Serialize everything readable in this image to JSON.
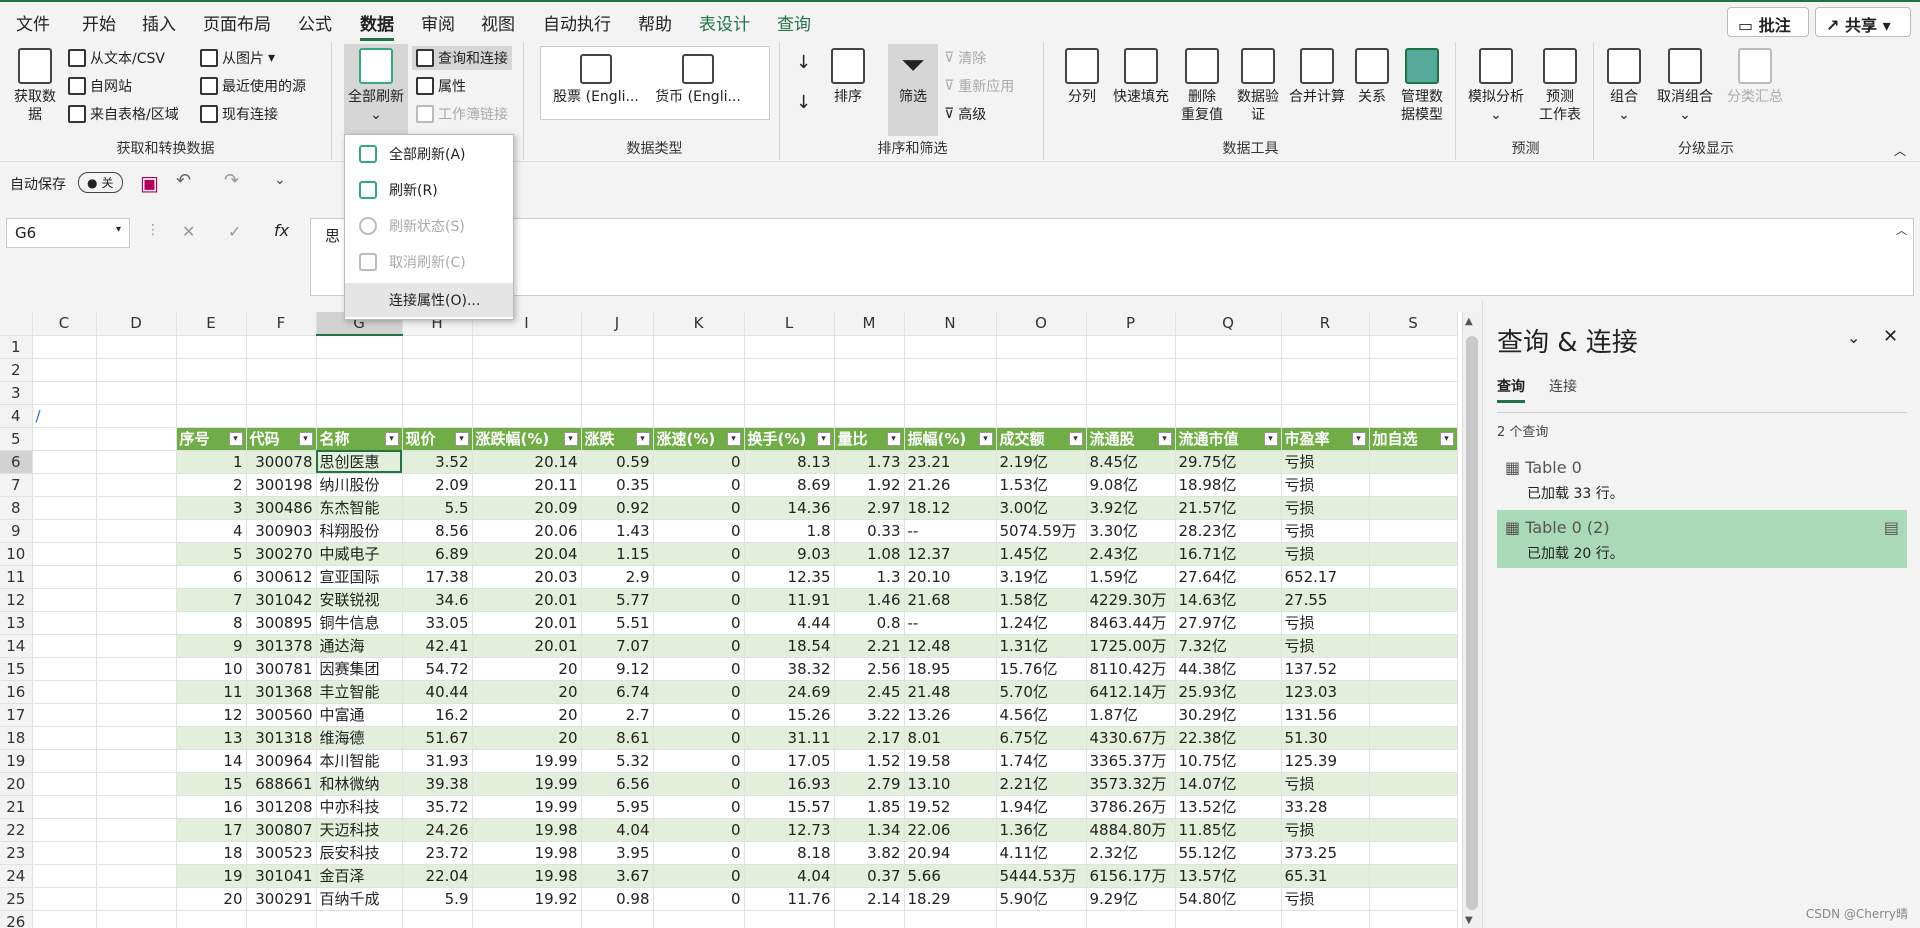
{
  "menu": {
    "tabs": [
      "文件",
      "开始",
      "插入",
      "页面布局",
      "公式",
      "数据",
      "审阅",
      "视图",
      "自动执行",
      "帮助",
      "表设计",
      "查询"
    ],
    "comment_btn": "批注",
    "share_btn": "共享"
  },
  "ribbon": {
    "get_data": {
      "big": "获取数\n据",
      "items": [
        "从文本/CSV",
        "自网站",
        "来自表格/区域",
        "从图片",
        "最近使用的源",
        "现有连接"
      ],
      "label": "获取和转换数据"
    },
    "queries": {
      "refresh_all": "全部刷新",
      "items": [
        "查询和连接",
        "属性",
        "工作簿链接"
      ]
    },
    "data_types": {
      "stock": "股票 (Engli...",
      "currency": "货币 (Engli...",
      "label": "数据类型"
    },
    "sort_filter": {
      "sort": "排序",
      "filter": "筛选",
      "clear": "清除",
      "reapply": "重新应用",
      "advanced": "高级",
      "label": "排序和筛选"
    },
    "data_tools": {
      "items": [
        "分列",
        "快速填充",
        "删除\n重复值",
        "数据验\n证",
        "合并计算",
        "关系",
        "管理数\n据模型"
      ],
      "label": "数据工具"
    },
    "forecast": {
      "items": [
        "模拟分析",
        "预测\n工作表"
      ],
      "label": "预测"
    },
    "outline": {
      "items": [
        "组合",
        "取消组合",
        "分类汇总"
      ],
      "label": "分级显示"
    }
  },
  "dropdown": {
    "items": [
      "全部刷新(A)",
      "刷新(R)",
      "刷新状态(S)",
      "取消刷新(C)",
      "连接属性(O)..."
    ]
  },
  "quick": {
    "autosave": "自动保存",
    "toggle": "关"
  },
  "formula": {
    "cell": "G6",
    "fx": "fx",
    "content": "思"
  },
  "columns": [
    "C",
    "D",
    "E",
    "F",
    "G",
    "H",
    "I",
    "J",
    "K",
    "L",
    "M",
    "N",
    "O",
    "P",
    "Q",
    "R",
    "S"
  ],
  "headers": [
    "序号",
    "代码",
    "名称",
    "现价",
    "涨跌幅(%)",
    "涨跌",
    "涨速(%)",
    "换手(%)",
    "量比",
    "振幅(%)",
    "成交额",
    "流通股",
    "流通市值",
    "市盈率",
    "加自选"
  ],
  "rows": [
    [
      "1",
      "300078",
      "思创医惠",
      "3.52",
      "20.14",
      "0.59",
      "0",
      "8.13",
      "1.73",
      "23.21",
      "2.19亿",
      "8.45亿",
      "29.75亿",
      "亏损",
      ""
    ],
    [
      "2",
      "300198",
      "纳川股份",
      "2.09",
      "20.11",
      "0.35",
      "0",
      "8.69",
      "1.92",
      "21.26",
      "1.53亿",
      "9.08亿",
      "18.98亿",
      "亏损",
      ""
    ],
    [
      "3",
      "300486",
      "东杰智能",
      "5.5",
      "20.09",
      "0.92",
      "0",
      "14.36",
      "2.97",
      "18.12",
      "3.00亿",
      "3.92亿",
      "21.57亿",
      "亏损",
      ""
    ],
    [
      "4",
      "300903",
      "科翔股份",
      "8.56",
      "20.06",
      "1.43",
      "0",
      "1.8",
      "0.33",
      "--",
      "5074.59万",
      "3.30亿",
      "28.23亿",
      "亏损",
      ""
    ],
    [
      "5",
      "300270",
      "中威电子",
      "6.89",
      "20.04",
      "1.15",
      "0",
      "9.03",
      "1.08",
      "12.37",
      "1.45亿",
      "2.43亿",
      "16.71亿",
      "亏损",
      ""
    ],
    [
      "6",
      "300612",
      "宣亚国际",
      "17.38",
      "20.03",
      "2.9",
      "0",
      "12.35",
      "1.3",
      "20.10",
      "3.19亿",
      "1.59亿",
      "27.64亿",
      "652.17",
      ""
    ],
    [
      "7",
      "301042",
      "安联锐视",
      "34.6",
      "20.01",
      "5.77",
      "0",
      "11.91",
      "1.46",
      "21.68",
      "1.58亿",
      "4229.30万",
      "14.63亿",
      "27.55",
      ""
    ],
    [
      "8",
      "300895",
      "铜牛信息",
      "33.05",
      "20.01",
      "5.51",
      "0",
      "4.44",
      "0.8",
      "--",
      "1.24亿",
      "8463.44万",
      "27.97亿",
      "亏损",
      ""
    ],
    [
      "9",
      "301378",
      "通达海",
      "42.41",
      "20.01",
      "7.07",
      "0",
      "18.54",
      "2.21",
      "12.48",
      "1.31亿",
      "1725.00万",
      "7.32亿",
      "亏损",
      ""
    ],
    [
      "10",
      "300781",
      "因赛集团",
      "54.72",
      "20",
      "9.12",
      "0",
      "38.32",
      "2.56",
      "18.95",
      "15.76亿",
      "8110.42万",
      "44.38亿",
      "137.52",
      ""
    ],
    [
      "11",
      "301368",
      "丰立智能",
      "40.44",
      "20",
      "6.74",
      "0",
      "24.69",
      "2.45",
      "21.48",
      "5.70亿",
      "6412.14万",
      "25.93亿",
      "123.03",
      ""
    ],
    [
      "12",
      "300560",
      "中富通",
      "16.2",
      "20",
      "2.7",
      "0",
      "15.26",
      "3.22",
      "13.26",
      "4.56亿",
      "1.87亿",
      "30.29亿",
      "131.56",
      ""
    ],
    [
      "13",
      "301318",
      "维海德",
      "51.67",
      "20",
      "8.61",
      "0",
      "31.11",
      "2.17",
      "8.01",
      "6.75亿",
      "4330.67万",
      "22.38亿",
      "51.30",
      ""
    ],
    [
      "14",
      "300964",
      "本川智能",
      "31.93",
      "19.99",
      "5.32",
      "0",
      "17.05",
      "1.52",
      "19.58",
      "1.74亿",
      "3365.37万",
      "10.75亿",
      "125.39",
      ""
    ],
    [
      "15",
      "688661",
      "和林微纳",
      "39.38",
      "19.99",
      "6.56",
      "0",
      "16.93",
      "2.79",
      "13.10",
      "2.21亿",
      "3573.32万",
      "14.07亿",
      "亏损",
      ""
    ],
    [
      "16",
      "301208",
      "中亦科技",
      "35.72",
      "19.99",
      "5.95",
      "0",
      "15.57",
      "1.85",
      "19.52",
      "1.94亿",
      "3786.26万",
      "13.52亿",
      "33.28",
      ""
    ],
    [
      "17",
      "300807",
      "天迈科技",
      "24.26",
      "19.98",
      "4.04",
      "0",
      "12.73",
      "1.34",
      "22.06",
      "1.36亿",
      "4884.80万",
      "11.85亿",
      "亏损",
      ""
    ],
    [
      "18",
      "300523",
      "辰安科技",
      "23.72",
      "19.98",
      "3.95",
      "0",
      "8.18",
      "3.82",
      "20.94",
      "4.11亿",
      "2.32亿",
      "55.12亿",
      "373.25",
      ""
    ],
    [
      "19",
      "301041",
      "金百泽",
      "22.04",
      "19.98",
      "3.67",
      "0",
      "4.04",
      "0.37",
      "5.66",
      "5444.53万",
      "6156.17万",
      "13.57亿",
      "65.31",
      ""
    ],
    [
      "20",
      "300291",
      "百纳千成",
      "5.9",
      "19.92",
      "0.98",
      "0",
      "11.76",
      "2.14",
      "18.29",
      "5.90亿",
      "9.29亿",
      "54.80亿",
      "亏损",
      ""
    ]
  ],
  "row_numbers": [
    "1",
    "2",
    "3",
    "4",
    "5",
    "6",
    "7",
    "8",
    "9",
    "10",
    "11",
    "12",
    "13",
    "14",
    "15",
    "16",
    "17",
    "18",
    "19",
    "20",
    "21",
    "22",
    "23",
    "24",
    "25",
    "26"
  ],
  "row4_mark": "/",
  "pane": {
    "title": "查询 & 连接",
    "tabs": [
      "查询",
      "连接"
    ],
    "count": "2 个查询",
    "queries": [
      {
        "name": "Table 0",
        "status": "已加载 33 行。"
      },
      {
        "name": "Table 0 (2)",
        "status": "已加载 20 行。"
      }
    ]
  },
  "watermark": "CSDN @Cherry晴"
}
